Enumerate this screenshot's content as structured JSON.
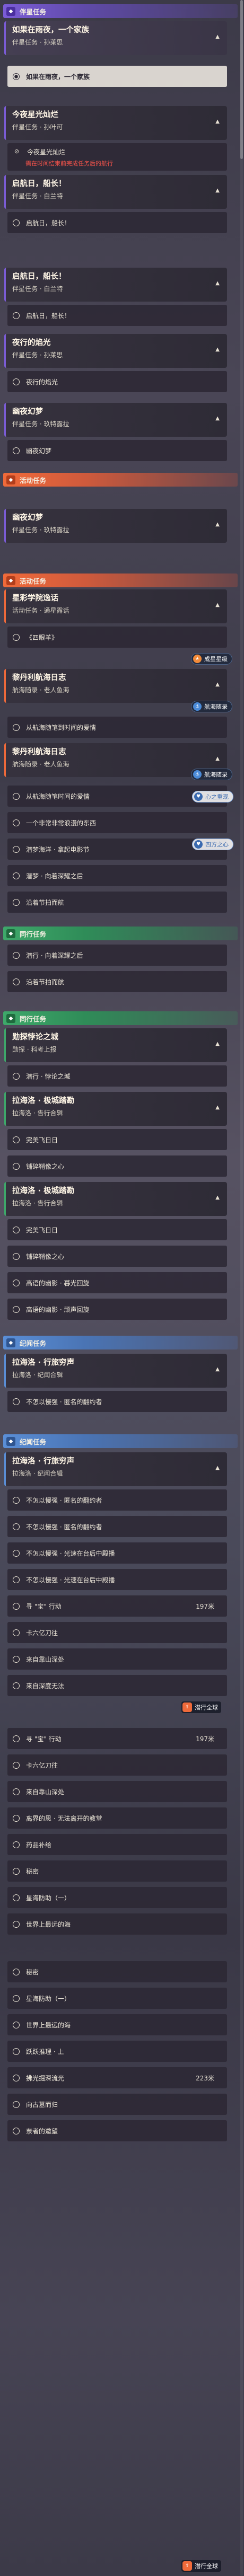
{
  "headers": {
    "trail1": "伴星任务",
    "event1": "活动任务",
    "event2": "活动任务",
    "comp1": "同行任务",
    "comp2": "同行任务",
    "mem1": "纪闻任务",
    "mem2": "纪闻任务"
  },
  "quests": [
    {
      "title": "如果在雨夜，一个家族",
      "sub": "伴星任务 · 孙莱思"
    },
    {
      "title": "今夜星光灿烂",
      "sub": "伴星任务 · 孙叶可"
    },
    {
      "title": "启航日，船长！",
      "sub": "伴星任务 · 白兰特"
    },
    {
      "title": "启航日，船长！",
      "sub": "伴星任务 · 白兰特"
    },
    {
      "title": "夜行的焰光",
      "sub": "伴星任务 · 孙莱思"
    },
    {
      "title": "幽夜幻梦",
      "sub": "伴星任务 · 玖特露拉"
    },
    {
      "title": "幽夜幻梦",
      "sub": "伴星任务 · 玖特露拉"
    },
    {
      "title": "星彩学院逸话",
      "sub": "活动任务 · 通星露话"
    },
    {
      "title": "黎丹利航海日志",
      "sub": "航海随录 · 老人鱼海"
    },
    {
      "title": "黎丹利航海日志",
      "sub": "航海随录 · 老人鱼海"
    },
    {
      "title": "勋探悖论之城",
      "sub": "勋探 · 科考上报"
    },
    {
      "title": "拉海洛 · 极城踏勘",
      "sub": "拉海洛 · 告行合辑"
    },
    {
      "title": "拉海洛 · 极城踏勘",
      "sub": "拉海洛 · 告行合辑"
    },
    {
      "title": "拉海洛 · 行旅穷声",
      "sub": "拉海洛 · 纪闻合辑"
    },
    {
      "title": "拉海洛 · 行旅穷声",
      "sub": "拉海洛 · 纪闻合辑"
    }
  ],
  "subs": [
    "如果在雨夜，一个家族",
    "今夜星光灿烂",
    "需在时间结束前完成任务后的航行",
    "启航日，船长！",
    "启航日，船长！",
    "夜行的焰光",
    "幽夜幻梦",
    "《四眼羊》",
    "从航海随笔到时间的爱情",
    "从航海随笔时间的爱情",
    "一个非常非常浪漫的东西",
    "潜梦海洋 · 拿起电影节",
    "潜梦 · 向着深耀之后",
    "沿着节拍而航",
    "潜行 · 向着深耀之后",
    "沿着节拍而航",
    "潜行 · 悖论之城",
    "完美飞日日",
    "铺碎鞘像之心",
    "完美飞日日",
    "铺碎鞘像之心",
    "高语的幽影 · 暮光回旋",
    "高语的幽影 · 顽声回旋",
    "不怎以慢强 · 匿名的翻约者",
    "不怎以慢强 · 匿名的翻约者",
    "不怎以慢强 · 匿名的翻约者",
    "不怎以慢强 · 光速在台后中殿播",
    "不怎以慢强 · 光速在台后中殿播",
    "寻 \"宝\" 行动",
    "卡六亿刀往",
    "来自靠山深处",
    "来自深度无法",
    "寻 \"宝\" 行动",
    "卡六亿刀往",
    "来自靠山深处",
    "离界的思 · 无法离开的教堂",
    "药品补给",
    "秘密",
    "星海防助（一）",
    "世界上最远的海",
    "秘密",
    "星海防助（一）",
    "世界上最远的海",
    "跃跃推理 · 上",
    "拂光掘深流光",
    "向古墓而归",
    "奈者的邀望"
  ],
  "counts": {
    "a": "197米",
    "b": "197米",
    "c": "223米"
  },
  "tags": {
    "t1": "成星星级",
    "t2": "航海随录",
    "t3": "航海随录",
    "t4": "心之重现",
    "t5": "四方之心",
    "t6": "前往标记"
  },
  "bottom": {
    "b1": "潜行全球",
    "b2": "潜行全球"
  },
  "icons": {
    "header": "square-badge-icon",
    "radio": "radio-icon",
    "chevron": "chevron-icon",
    "warn": "warning-icon"
  },
  "colors": {
    "trail": "#7b5cd6",
    "event": "#f06a3a",
    "companion": "#3ea86a",
    "memory": "#5a8ed6"
  }
}
